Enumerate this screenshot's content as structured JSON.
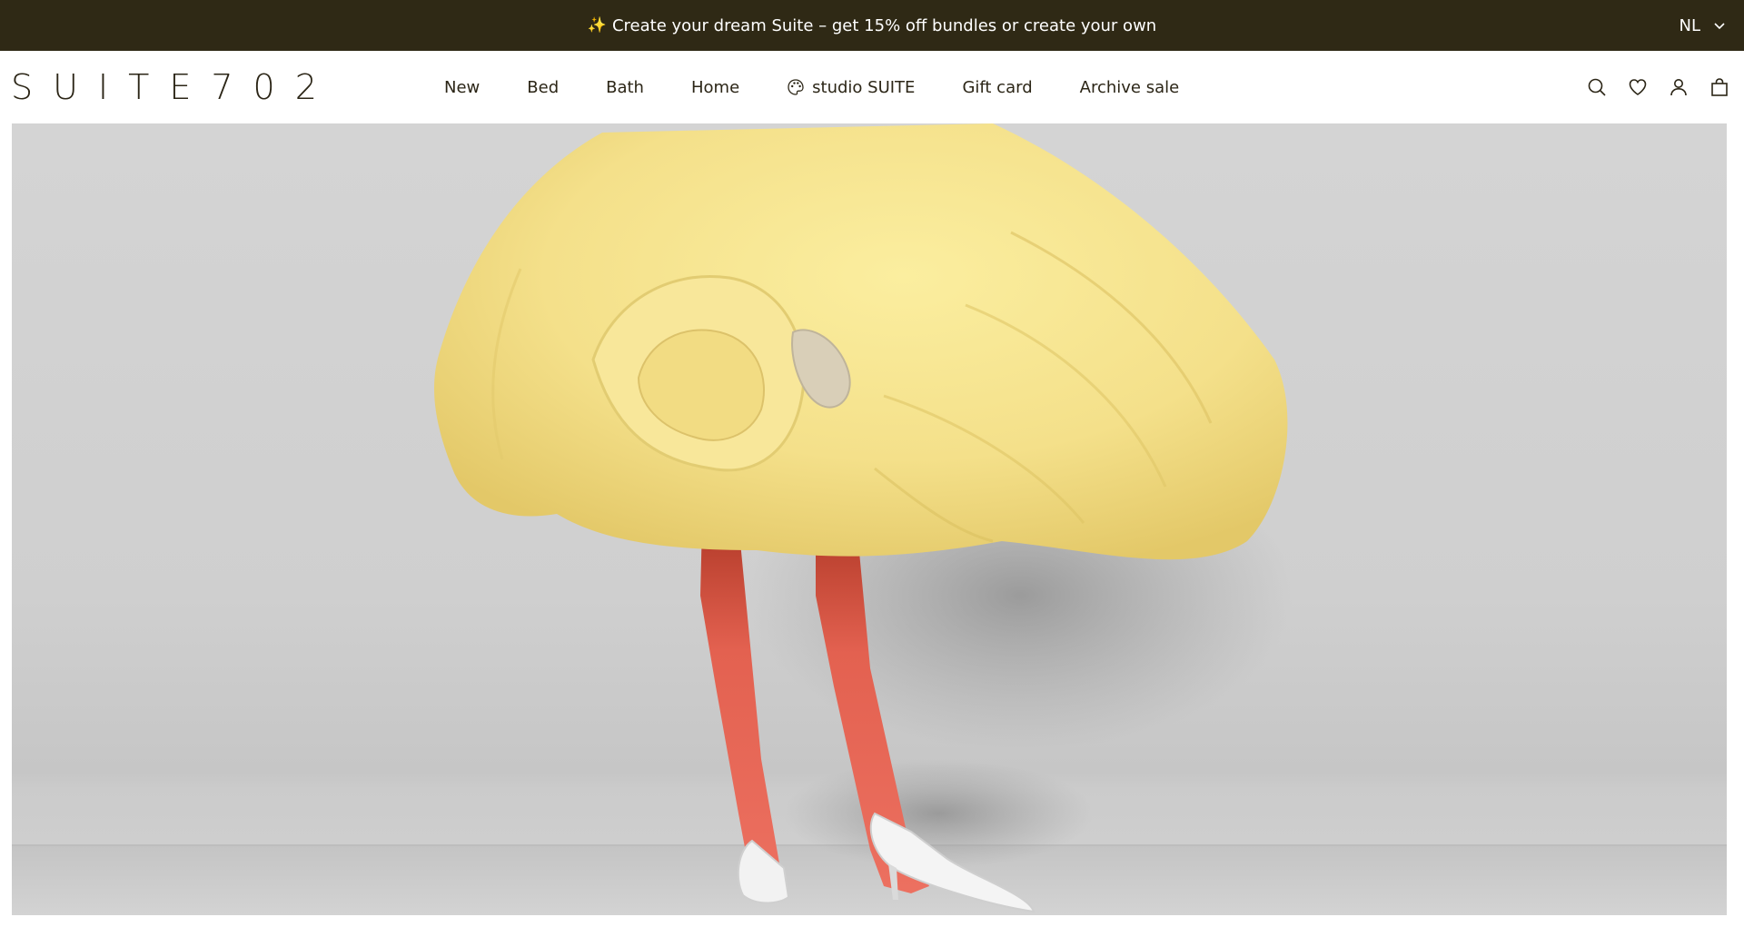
{
  "announcement": {
    "icon": "sparkles-icon",
    "text": "Create your dream Suite – get 15% off bundles or create your own"
  },
  "language": {
    "selected": "NL"
  },
  "brand": {
    "logo_text": "SUITE702"
  },
  "nav": {
    "items": [
      {
        "label": "New"
      },
      {
        "label": "Bed"
      },
      {
        "label": "Bath"
      },
      {
        "label": "Home"
      },
      {
        "label": "studio SUITE",
        "icon": "palette-icon"
      },
      {
        "label": "Gift card"
      },
      {
        "label": "Archive sale"
      }
    ]
  },
  "header_icons": [
    "search-icon",
    "heart-icon",
    "user-icon",
    "bag-icon"
  ],
  "colors": {
    "announcement_bg": "#2f2915",
    "text_dark": "#2b2516",
    "duvet_yellow": "#f5e28e",
    "tights_red": "#e86a55",
    "backdrop_grey": "#d0d0d0"
  }
}
